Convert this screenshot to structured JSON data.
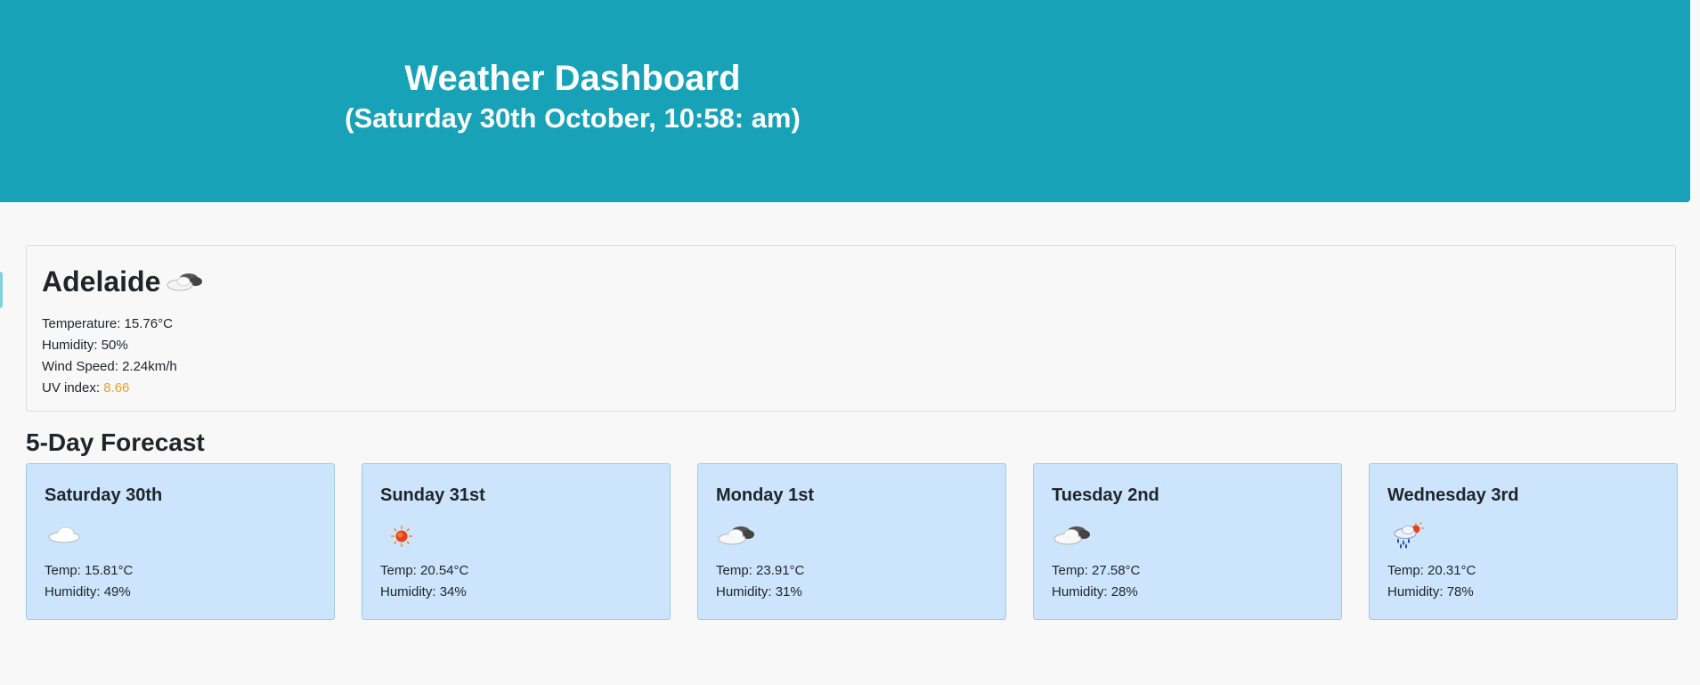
{
  "header": {
    "title": "Weather Dashboard",
    "date": "(Saturday 30th October, 10:58: am)",
    "background": "#17a2b8"
  },
  "current": {
    "city": "Adelaide",
    "icon": "cloudy-icon",
    "temperature_label": "Temperature: ",
    "temperature": "15.76°C",
    "humidity_label": "Humidity: ",
    "humidity": "50%",
    "wind_label": "Wind Speed: ",
    "wind": "2.24km/h",
    "uv_label": "UV index: ",
    "uv": "8.66",
    "uv_color": "#f0a028"
  },
  "forecast": {
    "title": "5-Day Forecast",
    "temp_label": "Temp: ",
    "humidity_label": "Humidity: ",
    "days": [
      {
        "day": "Saturday 30th",
        "icon": "cloud-icon",
        "temp": "15.81°C",
        "humidity": "49%"
      },
      {
        "day": "Sunday 31st",
        "icon": "sun-icon",
        "temp": "20.54°C",
        "humidity": "34%"
      },
      {
        "day": "Monday 1st",
        "icon": "cloudy-icon",
        "temp": "23.91°C",
        "humidity": "31%"
      },
      {
        "day": "Tuesday 2nd",
        "icon": "cloudy-icon",
        "temp": "27.58°C",
        "humidity": "28%"
      },
      {
        "day": "Wednesday 3rd",
        "icon": "rain-sun-icon",
        "temp": "20.31°C",
        "humidity": "78%"
      }
    ],
    "card_color": "#cce5fc"
  }
}
